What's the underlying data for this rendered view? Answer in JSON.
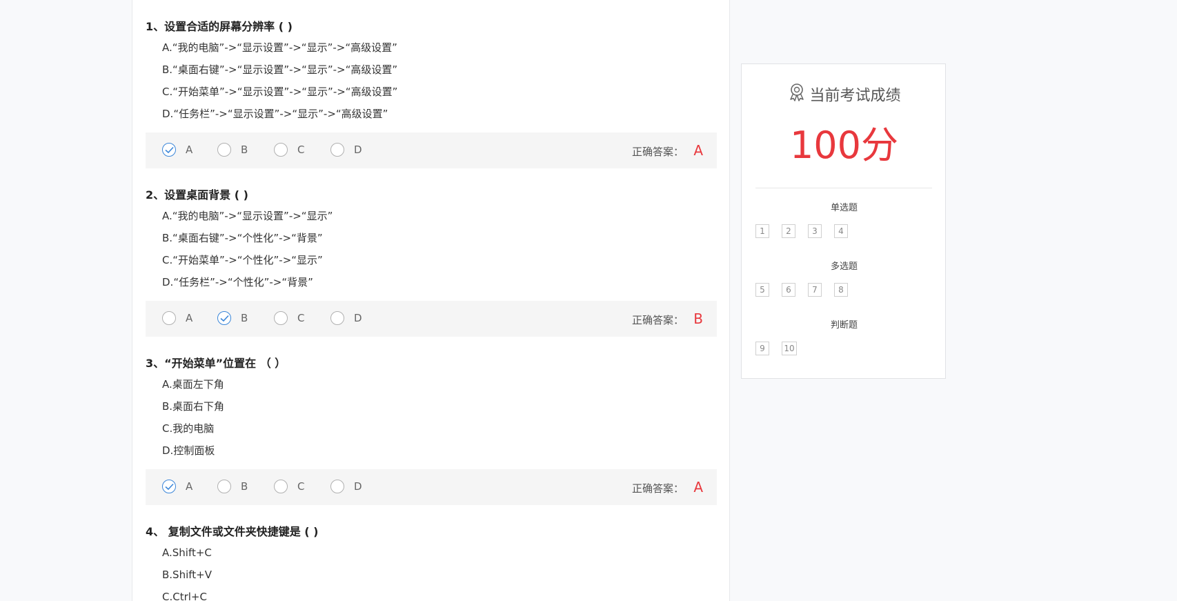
{
  "questions": [
    {
      "title": "1、设置合适的屏幕分辨率 ( )",
      "options": [
        "A.“我的电脑”->“显示设置”->“显示”->“高级设置”",
        "B.“桌面右键”->“显示设置”->“显示”->“高级设置”",
        "C.“开始菜单”->“显示设置”->“显示”->“高级设置”",
        "D.“任务栏”->“显示设置”->“显示”->“高级设置”"
      ],
      "choices": [
        "A",
        "B",
        "C",
        "D"
      ],
      "selected": "A",
      "correct_label": "正确答案：",
      "correct_answer": "A"
    },
    {
      "title": "2、设置桌面背景 ( )",
      "options": [
        "A.“我的电脑”->“显示设置”->“显示”",
        "B.“桌面右键”->“个性化”->“背景”",
        "C.“开始菜单”->“个性化”->“显示”",
        "D.“任务栏”->“个性化”->“背景”"
      ],
      "choices": [
        "A",
        "B",
        "C",
        "D"
      ],
      "selected": "B",
      "correct_label": "正确答案：",
      "correct_answer": "B"
    },
    {
      "title": "3、“开始菜单”位置在 （ ）",
      "options": [
        "A.桌面左下角",
        "B.桌面右下角",
        "C.我的电脑",
        "D.控制面板"
      ],
      "choices": [
        "A",
        "B",
        "C",
        "D"
      ],
      "selected": "A",
      "correct_label": "正确答案：",
      "correct_answer": "A"
    },
    {
      "title": "4、 复制文件或文件夹快捷键是 ( )",
      "options": [
        "A.Shift+C",
        "B.Shift+V",
        "C.Ctrl+C"
      ]
    }
  ],
  "score_card": {
    "header": "当前考试成绩",
    "score": "100分",
    "sections": [
      {
        "title": "单选题",
        "numbers": [
          "1",
          "2",
          "3",
          "4"
        ]
      },
      {
        "title": "多选题",
        "numbers": [
          "5",
          "6",
          "7",
          "8"
        ]
      },
      {
        "title": "判断题",
        "numbers": [
          "9",
          "10"
        ]
      }
    ]
  },
  "colors": {
    "accent_red": "#e8383d",
    "check_blue": "#3a86d9"
  }
}
